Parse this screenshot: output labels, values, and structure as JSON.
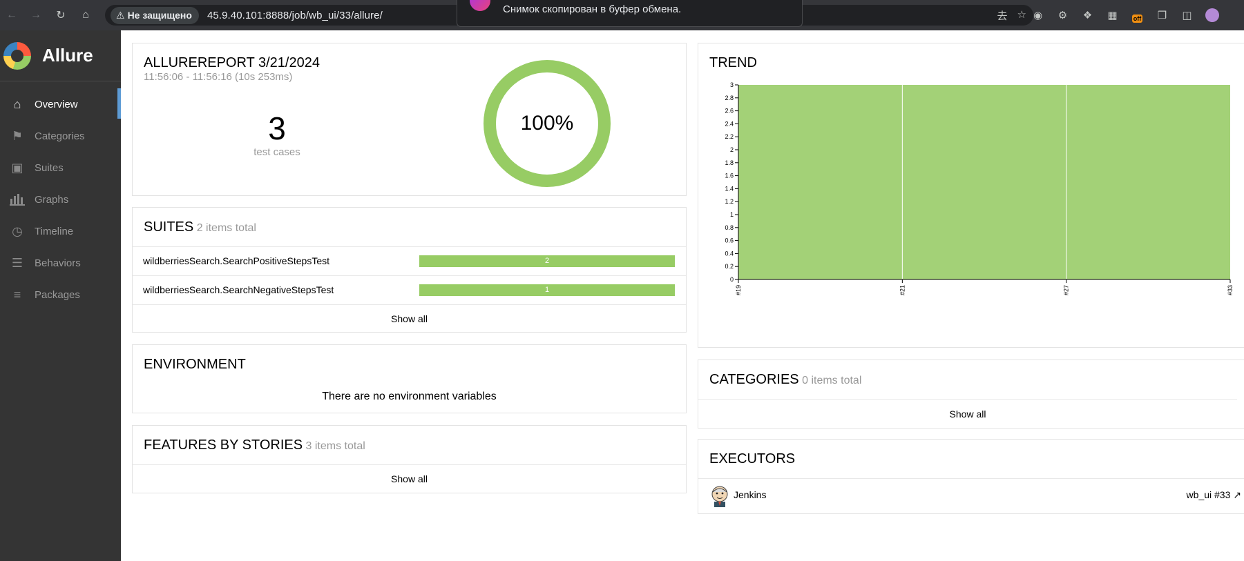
{
  "browser": {
    "back_icon": "arrow-left-icon",
    "security_label": "Не защищено",
    "url": "45.9.40.101:8888/job/wb_ui/33/allure/",
    "toast_text": "Снимок скопирован в буфер обмена.",
    "off_badge": "off"
  },
  "sidebar": {
    "brand": "Allure",
    "items": [
      {
        "label": "Overview",
        "icon": "home-icon"
      },
      {
        "label": "Categories",
        "icon": "flag-icon"
      },
      {
        "label": "Suites",
        "icon": "briefcase-icon"
      },
      {
        "label": "Graphs",
        "icon": "bar-chart-icon"
      },
      {
        "label": "Timeline",
        "icon": "clock-icon"
      },
      {
        "label": "Behaviors",
        "icon": "list-icon"
      },
      {
        "label": "Packages",
        "icon": "align-left-icon"
      }
    ]
  },
  "summary": {
    "title": "ALLUREREPORT 3/21/2024",
    "time": "11:56:06 - 11:56:16 (10s 253ms)",
    "count": "3",
    "count_label": "test cases",
    "percent": "100%",
    "pass_fraction": 1.0,
    "pass_color": "#97cc64"
  },
  "suites": {
    "title": "SUITES",
    "subtitle": "2 items total",
    "rows": [
      {
        "name": "wildberriesSearch.SearchPositiveStepsTest",
        "value": "2"
      },
      {
        "name": "wildberriesSearch.SearchNegativeStepsTest",
        "value": "1"
      }
    ],
    "show_all": "Show all"
  },
  "environment": {
    "title": "ENVIRONMENT",
    "empty": "There are no environment variables"
  },
  "features": {
    "title": "FEATURES BY STORIES",
    "subtitle": "3 items total",
    "show_all": "Show all"
  },
  "trend": {
    "title": "TREND"
  },
  "categories": {
    "title": "CATEGORIES",
    "subtitle": "0 items total",
    "show_all": "Show all"
  },
  "executors": {
    "title": "EXECUTORS",
    "name": "Jenkins",
    "build": "wb_ui #33"
  },
  "chart_data": {
    "type": "area",
    "x": [
      "#19",
      "#21",
      "#27",
      "#33"
    ],
    "series": [
      {
        "values": [
          3,
          3,
          3,
          3
        ],
        "color": "#97cc64"
      }
    ],
    "ylim": [
      0,
      3
    ],
    "yticks": [
      "0",
      "0.2",
      "0.4",
      "0.6",
      "0.8",
      "1",
      "1.2",
      "1.4",
      "1.6",
      "1.8",
      "2",
      "2.2",
      "2.4",
      "2.6",
      "2.8",
      "3"
    ],
    "grid": false
  }
}
